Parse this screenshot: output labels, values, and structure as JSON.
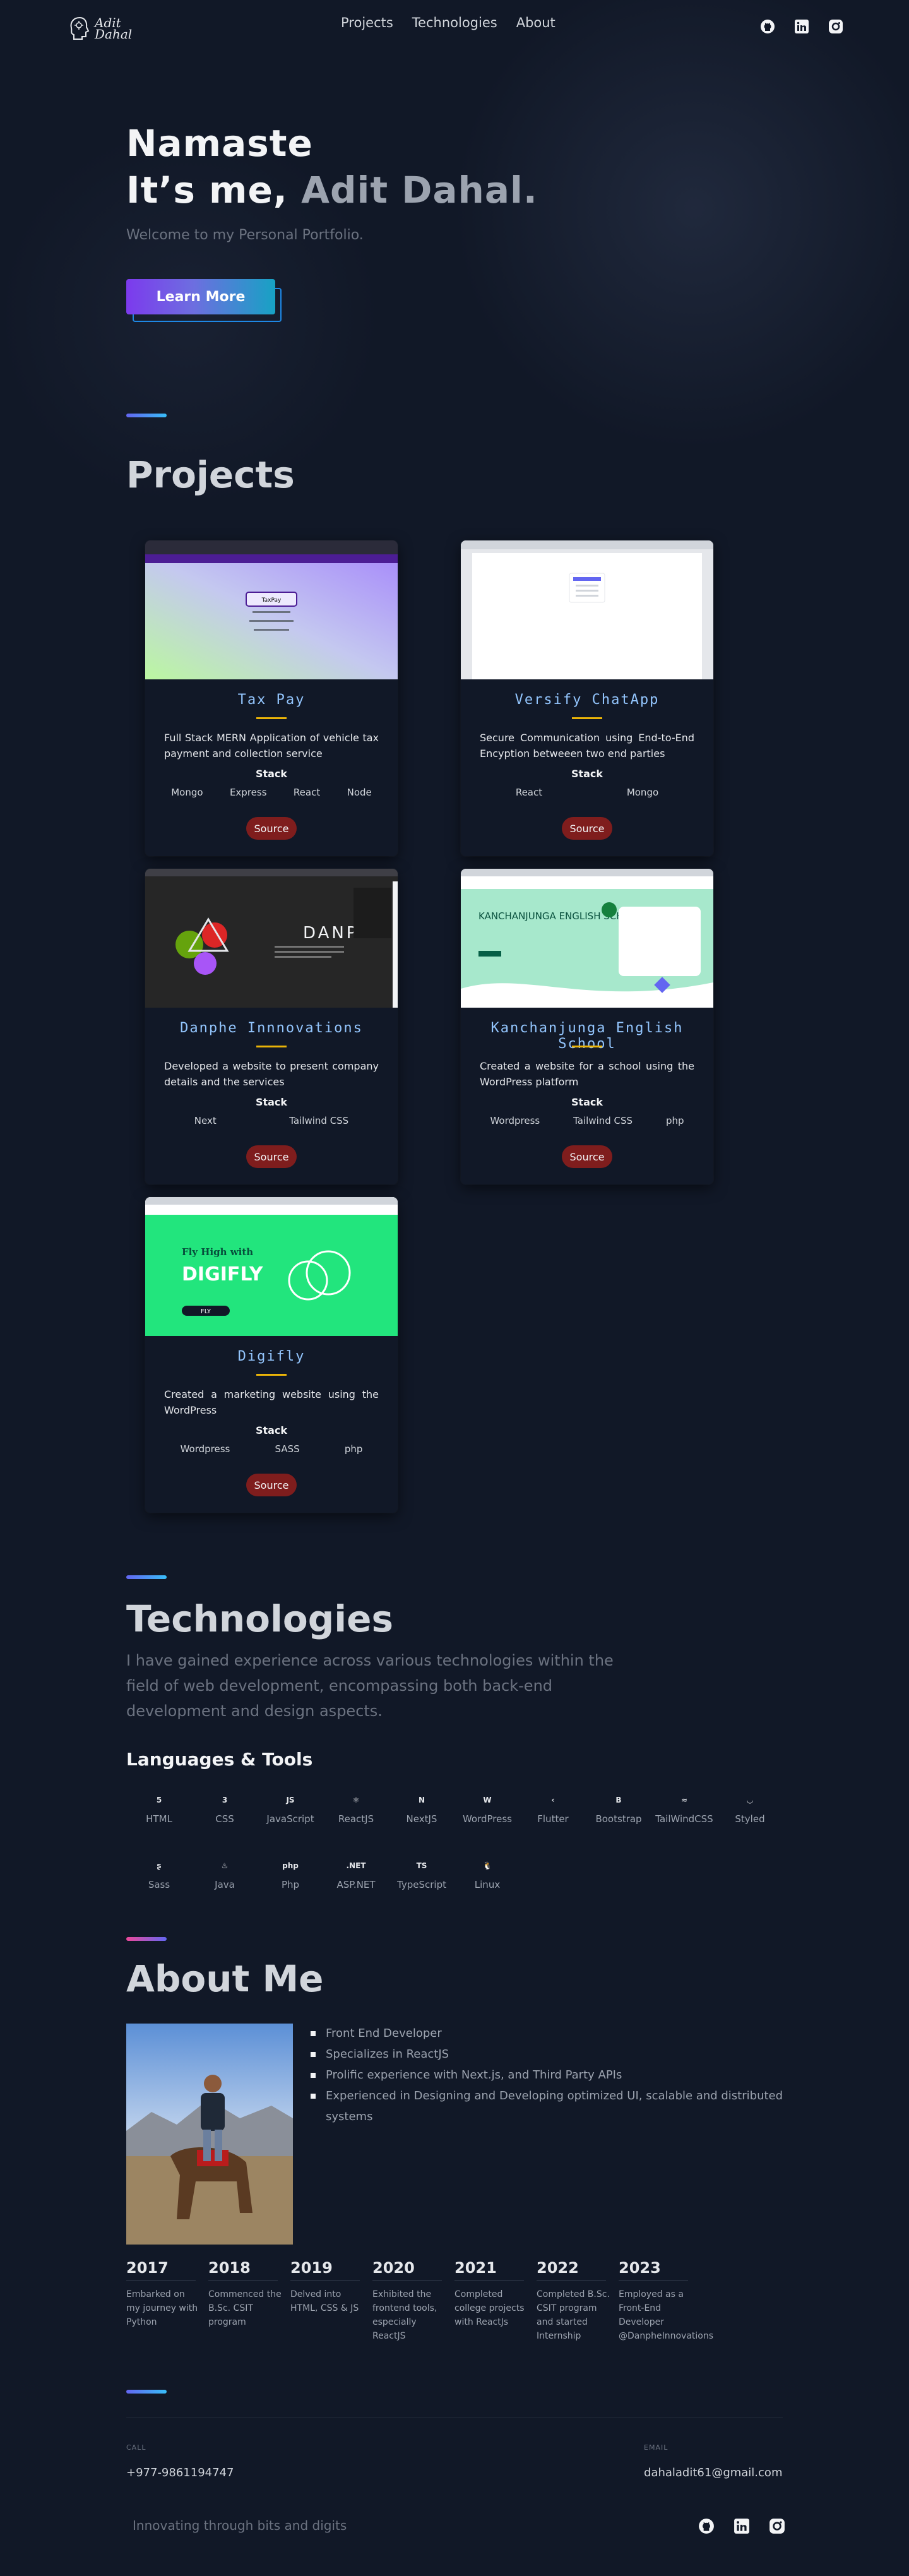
{
  "nav": {
    "logo_line1": "Adit",
    "logo_line2": "Dahal",
    "links": [
      "Projects",
      "Technologies",
      "About"
    ],
    "social_icons": [
      "github-icon",
      "linkedin-icon",
      "instagram-icon"
    ]
  },
  "hero": {
    "greeting": "Namaste",
    "intro": "It’s me, ",
    "name": "Adit Dahal.",
    "welcome": "Welcome to my Personal Portfolio.",
    "cta": "Learn More"
  },
  "projects": {
    "title": "Projects",
    "stack_label": "Stack",
    "source_label": "Source",
    "items": [
      {
        "name": "Tax Pay",
        "description": "Full Stack MERN Application of vehicle tax payment and collection service",
        "stack": [
          "Mongo",
          "Express",
          "React",
          "Node"
        ]
      },
      {
        "name": "Versify ChatApp",
        "description": "Secure Communication using End-to-End Encyption betweeen two end parties",
        "stack": [
          "React",
          "Mongo"
        ]
      },
      {
        "name": "Danphe Innnovations",
        "description": "Developed a website to present company details and the services",
        "stack": [
          "Next",
          "Tailwind CSS"
        ]
      },
      {
        "name": "Kanchanjunga English School",
        "description": "Created a website for a school using the WordPress platform",
        "stack": [
          "Wordpress",
          "Tailwind CSS",
          "php"
        ]
      },
      {
        "name": "Digifly",
        "description": "Created a marketing website using the WordPress",
        "stack": [
          "Wordpress",
          "SASS",
          "php"
        ]
      }
    ],
    "thumbs": {
      "taxpay_heading": "TaxPay",
      "danphe_heading": "DANPHE",
      "school_heading": "KANCHANJUNGA ENGLISH SCHOOL",
      "digifly_tagline": "Fly High with",
      "digifly_logo": "DIGIFLY",
      "digifly_btn": "FLY"
    }
  },
  "technologies": {
    "title": "Technologies",
    "description": "I have gained experience across various technologies within the field of web development, encompassing both back-end development and design aspects.",
    "languages_title": "Languages & Tools",
    "items": [
      {
        "label": "HTML",
        "icon": "html5-icon",
        "glyph": "5"
      },
      {
        "label": "CSS",
        "icon": "css3-icon",
        "glyph": "3"
      },
      {
        "label": "JavaScript",
        "icon": "javascript-icon",
        "glyph": "JS"
      },
      {
        "label": "ReactJS",
        "icon": "react-icon",
        "glyph": "⚛"
      },
      {
        "label": "NextJS",
        "icon": "nextjs-icon",
        "glyph": "N"
      },
      {
        "label": "WordPress",
        "icon": "wordpress-icon",
        "glyph": "W"
      },
      {
        "label": "Flutter",
        "icon": "flutter-icon",
        "glyph": "‹"
      },
      {
        "label": "Bootstrap",
        "icon": "bootstrap-icon",
        "glyph": "B"
      },
      {
        "label": "TailWindCSS",
        "icon": "tailwind-icon",
        "glyph": "≈"
      },
      {
        "label": "Styled",
        "icon": "styled-components-icon",
        "glyph": "◡"
      },
      {
        "label": "Sass",
        "icon": "sass-icon",
        "glyph": "ʂ"
      },
      {
        "label": "Java",
        "icon": "java-icon",
        "glyph": "♨"
      },
      {
        "label": "Php",
        "icon": "php-icon",
        "glyph": "php"
      },
      {
        "label": "ASP.NET",
        "icon": "dotnet-icon",
        "glyph": ".NET"
      },
      {
        "label": "TypeScript",
        "icon": "typescript-icon",
        "glyph": "TS"
      },
      {
        "label": "Linux",
        "icon": "linux-icon",
        "glyph": "🐧"
      }
    ]
  },
  "about": {
    "title": "About Me",
    "points": [
      "Front End Developer",
      "Specializes in ReactJS",
      "Prolific experience with Next.js, and Third Party APIs",
      "Experienced in Designing and Developing optimized UI, scalable and distributed systems"
    ],
    "timeline": [
      {
        "year": "2017",
        "text": "Embarked on my journey with Python"
      },
      {
        "year": "2018",
        "text": "Commenced the B.Sc. CSIT program"
      },
      {
        "year": "2019",
        "text": "Delved into HTML, CSS & JS"
      },
      {
        "year": "2020",
        "text": "Exhibited the frontend tools, especially ReactJS"
      },
      {
        "year": "2021",
        "text": "Completed college projects with ReactJs"
      },
      {
        "year": "2022",
        "text": "Completed B.Sc. CSIT program and started Internship"
      },
      {
        "year": "2023",
        "text": "Employed as a Front-End Developer @DanpheInnovations"
      }
    ]
  },
  "contact": {
    "call_label": "CALL",
    "phone": "+977-9861194747",
    "email_label": "EMAIL",
    "email": "dahaladit61@gmail.com"
  },
  "footer": {
    "tagline": "Innovating through bits and digits",
    "social_icons": [
      "github-icon",
      "linkedin-icon",
      "instagram-icon"
    ]
  },
  "colors": {
    "background": "#111827",
    "accent_blue": "#93c5fd",
    "accent_yellow": "#eab308",
    "source_button": "#7f1d1d"
  }
}
